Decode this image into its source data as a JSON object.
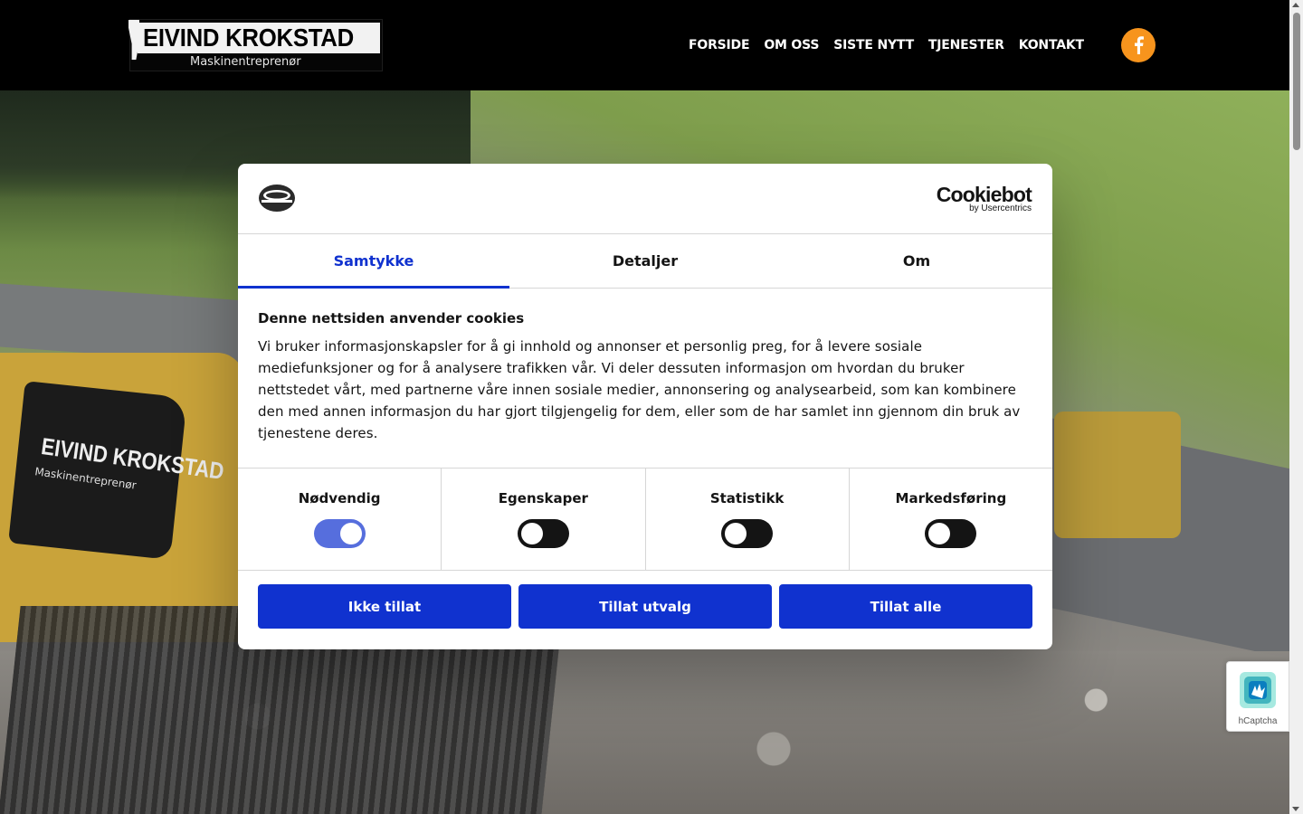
{
  "site": {
    "logo_title": "EIVIND KROKSTAD",
    "logo_subtitle": "Maskinentreprenør"
  },
  "nav": {
    "items": [
      {
        "label": "FORSIDE"
      },
      {
        "label": "OM OSS"
      },
      {
        "label": "SISTE NYTT"
      },
      {
        "label": "TJENESTER"
      },
      {
        "label": "KONTAKT"
      }
    ],
    "social_icon": "facebook-icon"
  },
  "hero": {
    "machine_logo": "EIVIND KROKSTAD",
    "machine_sub": "Maskinentreprenør"
  },
  "cookie_dialog": {
    "brand_name": "Cookiebot",
    "brand_by": "by Usercentrics",
    "tabs": [
      {
        "label": "Samtykke",
        "active": true
      },
      {
        "label": "Detaljer",
        "active": false
      },
      {
        "label": "Om",
        "active": false
      }
    ],
    "title": "Denne nettsiden anvender cookies",
    "text": "Vi bruker informasjonskapsler for å gi innhold og annonser et personlig preg, for å levere sosiale mediefunksjoner og for å analysere trafikken vår. Vi deler dessuten informasjon om hvordan du bruker nettstedet vårt, med partnerne våre innen sosiale medier, annonsering og analysearbeid, som kan kombinere den med annen informasjon du har gjort tilgjengelig for dem, eller som de har samlet inn gjennom din bruk av tjenestene deres.",
    "toggles": [
      {
        "label": "Nødvendig",
        "on": true
      },
      {
        "label": "Egenskaper",
        "on": false
      },
      {
        "label": "Statistikk",
        "on": false
      },
      {
        "label": "Markedsføring",
        "on": false
      }
    ],
    "buttons": {
      "deny": "Ikke tillat",
      "allow_selection": "Tillat utvalg",
      "allow_all": "Tillat alle"
    }
  },
  "hcaptcha": {
    "label": "hCaptcha"
  },
  "colors": {
    "accent": "#1032cf",
    "facebook_button": "#f7941d",
    "header_bg": "#000000"
  }
}
